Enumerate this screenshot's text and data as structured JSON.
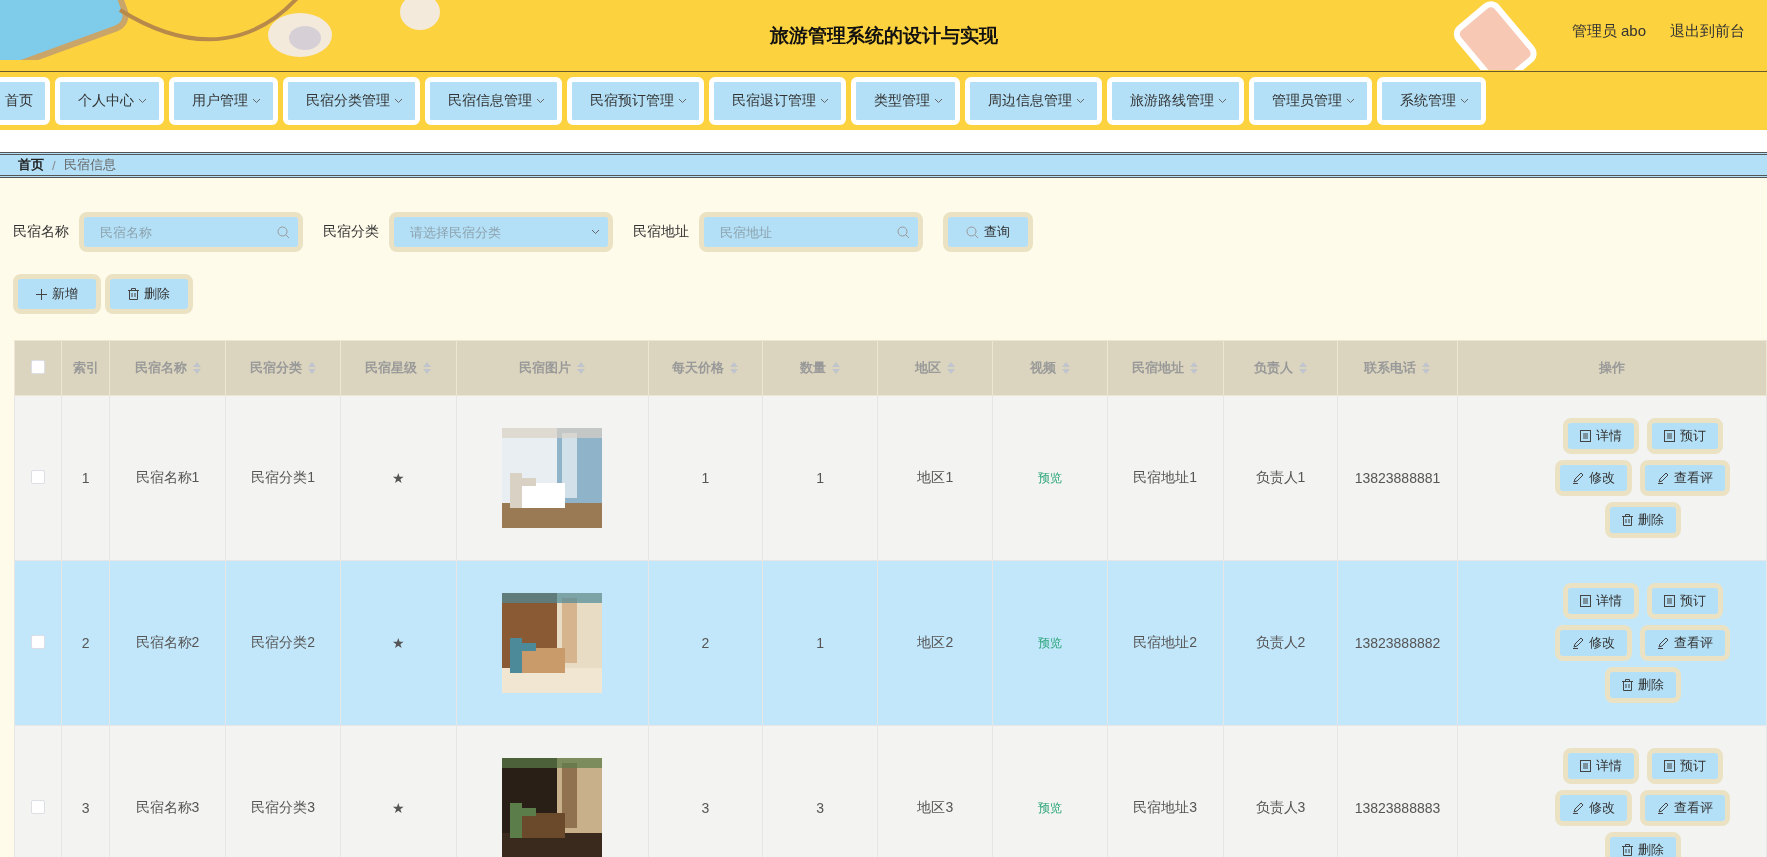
{
  "header": {
    "title": "旅游管理系统的设计与实现",
    "user": "管理员 abo",
    "exit_link": "退出到前台"
  },
  "nav": [
    {
      "label": "首页",
      "dropdown": false
    },
    {
      "label": "个人中心",
      "dropdown": true
    },
    {
      "label": "用户管理",
      "dropdown": true
    },
    {
      "label": "民宿分类管理",
      "dropdown": true
    },
    {
      "label": "民宿信息管理",
      "dropdown": true
    },
    {
      "label": "民宿预订管理",
      "dropdown": true
    },
    {
      "label": "民宿退订管理",
      "dropdown": true
    },
    {
      "label": "类型管理",
      "dropdown": true
    },
    {
      "label": "周边信息管理",
      "dropdown": true
    },
    {
      "label": "旅游路线管理",
      "dropdown": true
    },
    {
      "label": "管理员管理",
      "dropdown": true
    },
    {
      "label": "系统管理",
      "dropdown": true
    }
  ],
  "breadcrumb": [
    "首页",
    "民宿信息"
  ],
  "breadcrumb_separator": "/",
  "search": [
    {
      "label": "民宿名称",
      "kind": "text",
      "placeholder": "民宿名称"
    },
    {
      "label": "民宿分类",
      "kind": "select",
      "placeholder": "请选择民宿分类"
    },
    {
      "label": "民宿地址",
      "kind": "text",
      "placeholder": "民宿地址"
    }
  ],
  "query_button": "查询",
  "toolbar": [
    {
      "label": "新增",
      "kind": "add"
    },
    {
      "label": "删除",
      "kind": "delete"
    }
  ],
  "table": {
    "select_all_checked": false,
    "columns": [
      {
        "label": "索引",
        "sortable": false
      },
      {
        "label": "民宿名称",
        "sortable": true
      },
      {
        "label": "民宿分类",
        "sortable": true
      },
      {
        "label": "民宿星级",
        "sortable": true
      },
      {
        "label": "民宿图片",
        "sortable": true
      },
      {
        "label": "每天价格",
        "sortable": true
      },
      {
        "label": "数量",
        "sortable": true
      },
      {
        "label": "地区",
        "sortable": true
      },
      {
        "label": "视频",
        "sortable": true
      },
      {
        "label": "民宿地址",
        "sortable": true
      },
      {
        "label": "负责人",
        "sortable": true
      },
      {
        "label": "联系电话",
        "sortable": true
      },
      {
        "label": "操作",
        "sortable": false
      }
    ],
    "rows": [
      {
        "selected": false,
        "checked": false,
        "cells": [
          "1",
          "民宿名称1",
          "民宿分类1",
          "★",
          "",
          "1",
          "1",
          "地区1",
          "预览",
          "民宿地址1",
          "负责人1",
          "13823888881"
        ],
        "image": {
          "kind": "picture"
        },
        "actions": [
          {
            "label": "详情",
            "kind": "detail"
          },
          {
            "label": "预订",
            "kind": "detail"
          },
          {
            "label": "修改",
            "kind": "edit"
          },
          {
            "label": "查看评",
            "kind": "edit"
          },
          {
            "label": "删除",
            "kind": "delete"
          }
        ]
      },
      {
        "selected": true,
        "checked": false,
        "cells": [
          "2",
          "民宿名称2",
          "民宿分类2",
          "★",
          "",
          "2",
          "1",
          "地区2",
          "预览",
          "民宿地址2",
          "负责人2",
          "13823888882"
        ],
        "image": {
          "kind": "picture"
        },
        "actions": [
          {
            "label": "详情",
            "kind": "detail"
          },
          {
            "label": "预订",
            "kind": "detail"
          },
          {
            "label": "修改",
            "kind": "edit"
          },
          {
            "label": "查看评",
            "kind": "edit"
          },
          {
            "label": "删除",
            "kind": "delete"
          }
        ]
      },
      {
        "selected": false,
        "checked": false,
        "cells": [
          "3",
          "民宿名称3",
          "民宿分类3",
          "★",
          "",
          "3",
          "3",
          "地区3",
          "预览",
          "民宿地址3",
          "负责人3",
          "13823888883"
        ],
        "image": {
          "kind": "picture"
        },
        "actions": [
          {
            "label": "详情",
            "kind": "detail"
          },
          {
            "label": "预订",
            "kind": "detail"
          },
          {
            "label": "修改",
            "kind": "edit"
          },
          {
            "label": "查看评",
            "kind": "edit"
          },
          {
            "label": "删除",
            "kind": "delete"
          }
        ]
      }
    ]
  }
}
